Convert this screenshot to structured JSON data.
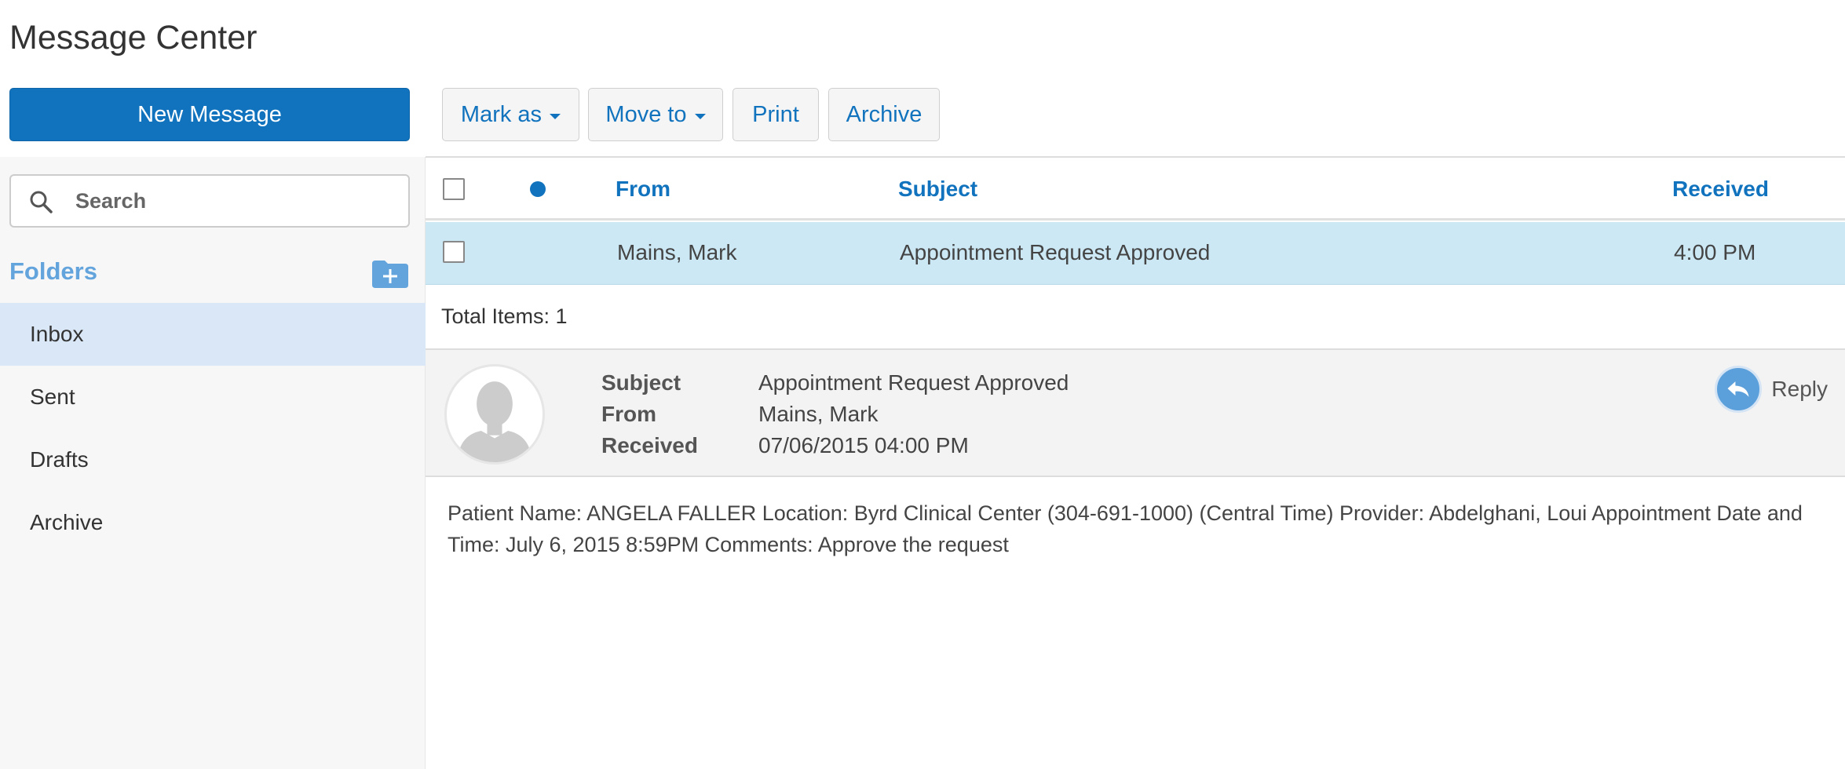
{
  "page": {
    "title": "Message Center"
  },
  "actions": {
    "new_message": "New Message",
    "mark_as": "Mark as",
    "move_to": "Move to",
    "print": "Print",
    "archive": "Archive"
  },
  "sidebar": {
    "search": {
      "placeholder": "Search",
      "value": ""
    },
    "folders_heading": "Folders",
    "folders": [
      {
        "label": "Inbox",
        "active": true
      },
      {
        "label": "Sent"
      },
      {
        "label": "Drafts"
      },
      {
        "label": "Archive"
      }
    ]
  },
  "message_list": {
    "columns": {
      "from": "From",
      "subject": "Subject",
      "received": "Received"
    },
    "rows": [
      {
        "from": "Mains, Mark",
        "subject": "Appointment Request Approved",
        "received": "4:00 PM",
        "selected": true
      }
    ],
    "total_items": "Total Items: 1"
  },
  "message_detail": {
    "subject_label": "Subject",
    "from_label": "From",
    "received_label": "Received",
    "subject": "Appointment Request Approved",
    "from": "Mains, Mark",
    "received": "07/06/2015 04:00 PM",
    "reply_label": "Reply",
    "body": "Patient Name: ANGELA FALLER Location: Byrd Clinical Center (304-691-1000) (Central Time) Provider: Abdelghani, Loui Appointment Date and Time: July 6, 2015 8:59PM Comments: Approve the request"
  },
  "colors": {
    "accent": "#1173bd",
    "folders_heading": "#63a4dd",
    "selected_row": "#cce8f5",
    "active_folder": "#d9e7f6"
  },
  "icons": {
    "search": "search-icon",
    "add_folder": "folder-add-icon",
    "reply": "reply-icon",
    "avatar": "user-silhouette-icon",
    "unread": "unread-dot-icon"
  }
}
